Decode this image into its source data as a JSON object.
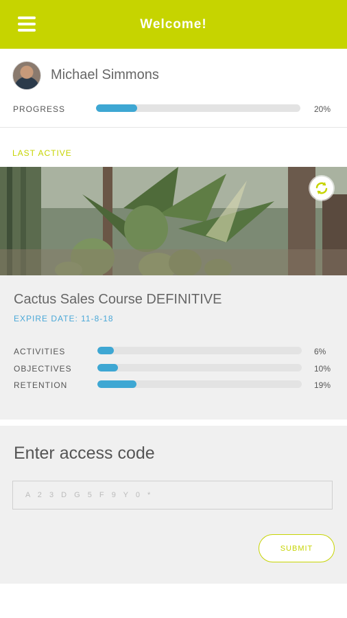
{
  "theme": {
    "accent": "#c6d400",
    "progress_bar": "#3ea7d3"
  },
  "header": {
    "title": "Welcome!",
    "menu_icon": "hamburger-menu-icon"
  },
  "profile": {
    "name": "Michael Simmons",
    "progress_label": "PROGRESS",
    "progress_text": "20%",
    "progress_value": 0.2
  },
  "last_active": {
    "label": "LAST ACTIVE",
    "refresh_icon": "refresh-icon",
    "course": {
      "title": "Cactus Sales Course DEFINITIVE",
      "expire": "EXPIRE DATE: 11-8-18",
      "stats": [
        {
          "label": "ACTIVITIES",
          "text": "6%",
          "value": 0.06
        },
        {
          "label": "OBJECTIVES",
          "text": "10%",
          "value": 0.1
        },
        {
          "label": "RETENTION",
          "text": "19%",
          "value": 0.19
        }
      ]
    }
  },
  "access": {
    "title": "Enter access code",
    "placeholder": "A 2 3 D G 5 F 9 Y 0 *",
    "value": "",
    "submit_label": "SUBMIT"
  }
}
